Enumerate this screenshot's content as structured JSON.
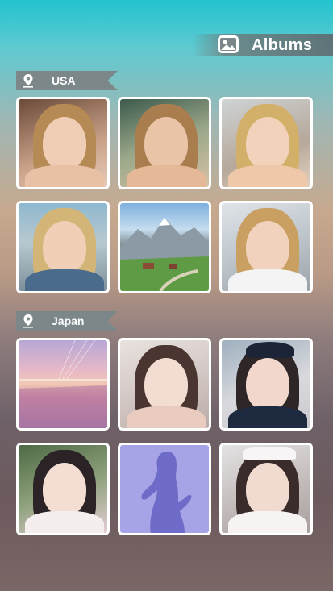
{
  "header": {
    "title": "Albums",
    "icon": "gallery-icon"
  },
  "sections": [
    {
      "name": "USA",
      "icon": "location-pin-icon",
      "photos": [
        {
          "kind": "portrait"
        },
        {
          "kind": "portrait"
        },
        {
          "kind": "portrait"
        },
        {
          "kind": "portrait"
        },
        {
          "kind": "landscape"
        },
        {
          "kind": "portrait"
        }
      ]
    },
    {
      "name": "Japan",
      "icon": "location-pin-icon",
      "photos": [
        {
          "kind": "sunset-sea"
        },
        {
          "kind": "portrait"
        },
        {
          "kind": "portrait"
        },
        {
          "kind": "portrait"
        },
        {
          "kind": "locked-silhouette"
        },
        {
          "kind": "portrait"
        }
      ]
    }
  ],
  "colors": {
    "locked_tile": "#a6a3e6",
    "silhouette": "#6f6bc8"
  }
}
